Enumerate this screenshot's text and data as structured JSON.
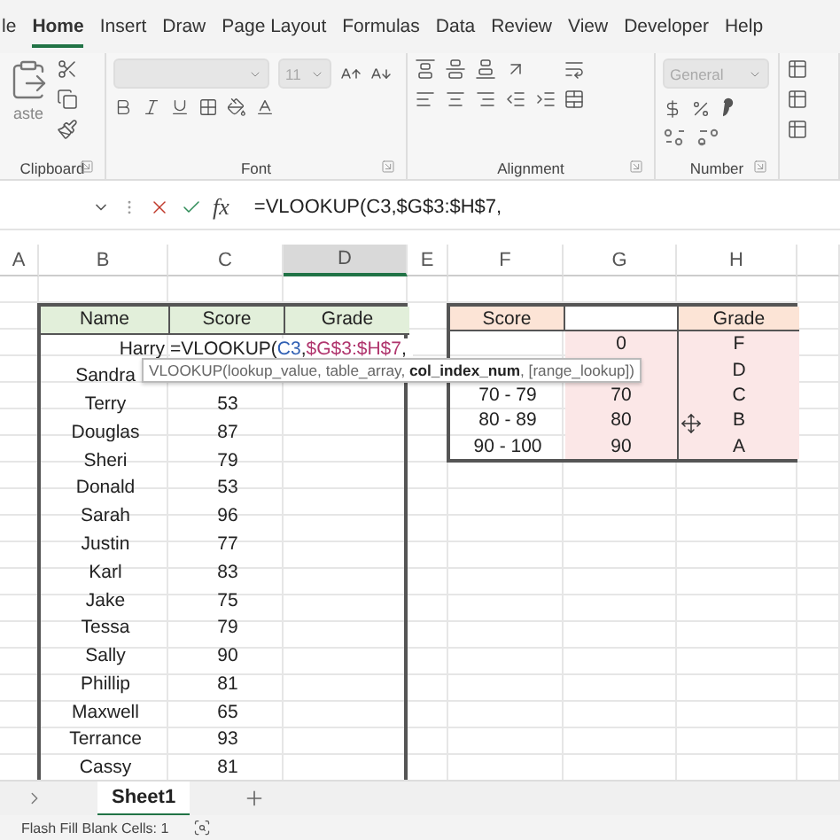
{
  "ribbon_tabs": [
    {
      "label": "le",
      "selected": false
    },
    {
      "label": "Home",
      "selected": true
    },
    {
      "label": "Insert",
      "selected": false
    },
    {
      "label": "Draw",
      "selected": false
    },
    {
      "label": "Page Layout",
      "selected": false
    },
    {
      "label": "Formulas",
      "selected": false
    },
    {
      "label": "Data",
      "selected": false
    },
    {
      "label": "Review",
      "selected": false
    },
    {
      "label": "View",
      "selected": false
    },
    {
      "label": "Developer",
      "selected": false
    },
    {
      "label": "Help",
      "selected": false
    }
  ],
  "ribbon": {
    "paste_label": "aste",
    "font_size": {
      "value": "11",
      "disabled": true
    },
    "font_name": {
      "disabled": true
    },
    "number_format": {
      "value": "General",
      "disabled": true
    },
    "groups": [
      "Clipboard",
      "Font",
      "Alignment",
      "Number"
    ]
  },
  "formula_bar": {
    "fx": "fx",
    "formula": "=VLOOKUP(C3,$G$3:$H$7,"
  },
  "columns": [
    {
      "label": "A",
      "selected": false
    },
    {
      "label": "B",
      "selected": false
    },
    {
      "label": "C",
      "selected": false
    },
    {
      "label": "D",
      "selected": true
    },
    {
      "label": "E",
      "selected": false
    },
    {
      "label": "F",
      "selected": false
    },
    {
      "label": "G",
      "selected": false
    },
    {
      "label": "H",
      "selected": false
    }
  ],
  "left_table": {
    "columns": [
      "Name",
      "Score",
      "Grade"
    ],
    "rows": [
      {
        "name": "Harry"
      },
      {
        "name": "Sandra"
      },
      {
        "name": "Terry",
        "score": "53"
      },
      {
        "name": "Douglas",
        "score": "87"
      },
      {
        "name": "Sheri",
        "score": "79"
      },
      {
        "name": "Donald",
        "score": "53"
      },
      {
        "name": "Sarah",
        "score": "96"
      },
      {
        "name": "Justin",
        "score": "77"
      },
      {
        "name": "Karl",
        "score": "83"
      },
      {
        "name": "Jake",
        "score": "75"
      },
      {
        "name": "Tessa",
        "score": "79"
      },
      {
        "name": "Sally",
        "score": "90"
      },
      {
        "name": "Phillip",
        "score": "81"
      },
      {
        "name": "Maxwell",
        "score": "65"
      },
      {
        "name": "Terrance",
        "score": "93"
      },
      {
        "name": "Cassy",
        "score": "81"
      }
    ]
  },
  "editing_cell": {
    "parts": [
      {
        "kind": "plain",
        "text": "=VLOOKUP("
      },
      {
        "kind": "ref_first",
        "text": "C3"
      },
      {
        "kind": "plain",
        "text": ","
      },
      {
        "kind": "ref_second",
        "text": "$G$3:$H$7"
      },
      {
        "kind": "plain",
        "text": ","
      }
    ]
  },
  "tooltip": "VLOOKUP(lookup_value, table_array, **col_index_num**, [range_lookup])",
  "right_table": {
    "score_header": "Score",
    "grade_header": "Grade",
    "rows": [
      {
        "column_2": "0",
        "grade": "F"
      },
      {
        "grade": "D"
      },
      {
        "score": "70 - 79",
        "column_2": "70",
        "grade": "C"
      },
      {
        "score": "80 - 89",
        "column_2": "80",
        "grade": "B"
      },
      {
        "score": "90 - 100",
        "column_2": "90",
        "grade": "A"
      }
    ]
  },
  "sheet_tabs": [
    {
      "label": "Sheet1",
      "selected": true
    }
  ],
  "status_bar": {
    "text": "Flash Fill Blank Cells: 1"
  }
}
